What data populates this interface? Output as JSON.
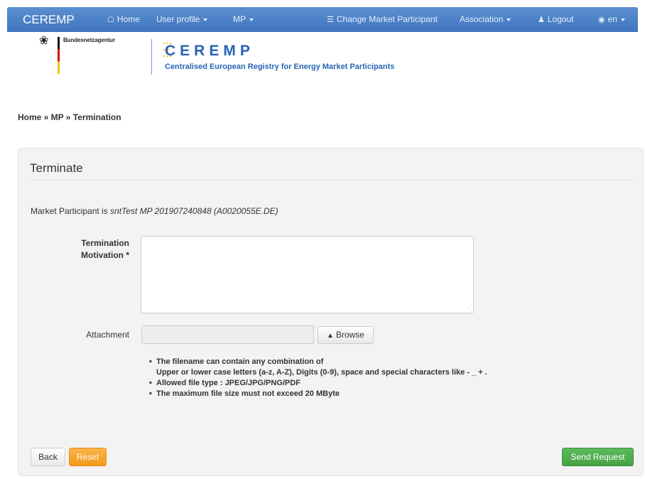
{
  "navbar": {
    "brand": "CEREMP",
    "home": "Home",
    "user_profile": "User profile",
    "mp": "MP",
    "change_mp": "Change Market Participant",
    "association": "Association",
    "logout": "Logout",
    "language": "en",
    "icons": {
      "home": "home-icon",
      "change_mp": "list-icon",
      "logout": "user-icon",
      "language": "globe-icon"
    }
  },
  "header": {
    "bna_text": "Bundesnetzagentur",
    "ceremp_wordmark": "CEREMP",
    "ceremp_tagline": "Centralised European Registry for Energy Market Participants"
  },
  "breadcrumb": "Home » MP » Termination",
  "panel": {
    "title": "Terminate",
    "mp_prefix": "Market Participant is ",
    "mp_value": "sntTest MP 201907240848 (A0020055E.DE)",
    "motivation_label": "Termination Motivation *",
    "motivation_value": "",
    "attachment_label": "Attachment",
    "attachment_value": "",
    "browse_label": "Browse",
    "rules": [
      "The filename can contain any combination of",
      "Upper or lower case letters (a-z, A-Z), Digits (0-9), space and special characters like - _ + .",
      "Allowed file type : JPEG/JPG/PNG/PDF",
      "The maximum file size must not exceed 20 MByte"
    ],
    "back_label": "Back",
    "reset_label": "Reset",
    "send_label": "Send Request"
  },
  "colors": {
    "navbar": "#4a80c8",
    "brand_blue": "#2764b5",
    "reset_orange": "#f5a030",
    "send_green": "#4cae4c",
    "panel_bg": "#f3f3f3"
  }
}
